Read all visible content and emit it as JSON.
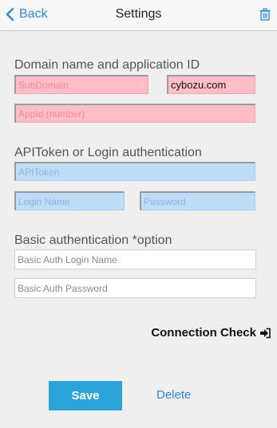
{
  "navbar": {
    "back_label": "Back",
    "title": "Settings",
    "icons": {
      "back": "chevron-left-icon",
      "trash": "trash-icon"
    }
  },
  "domain_section": {
    "title": "Domain name and application ID",
    "subdomain_placeholder": "SubDomain",
    "domain_value": "cybozu.com",
    "appid_placeholder": "AppId (number)"
  },
  "auth_section": {
    "title": "APIToken or Login authentication",
    "apitoken_placeholder": "APIToken",
    "login_placeholder": "Login Name",
    "password_placeholder": "Password"
  },
  "basic_section": {
    "title": "Basic authentication *option",
    "login_placeholder": "Basic Auth Login Name",
    "password_placeholder": "Basic Auth Password"
  },
  "actions": {
    "connection_check_label": "Connection Check",
    "connection_check_icon": "sign-in-icon",
    "save_label": "Save",
    "delete_label": "Delete"
  },
  "colors": {
    "accent": "#2aa3d8",
    "link": "#2e8ad2",
    "required_field": "#ffbdc7",
    "auth_field": "#bfdcf7",
    "background": "#efefef"
  }
}
